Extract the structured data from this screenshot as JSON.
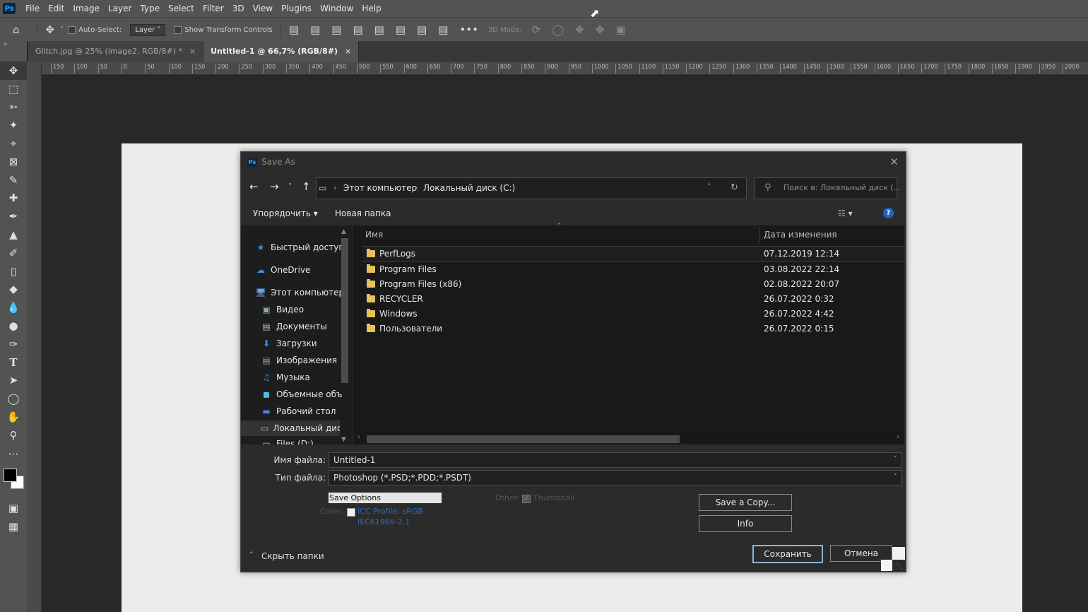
{
  "app": {
    "menu": [
      "File",
      "Edit",
      "Image",
      "Layer",
      "Type",
      "Select",
      "Filter",
      "3D",
      "View",
      "Plugins",
      "Window",
      "Help"
    ],
    "logo": "Ps"
  },
  "options_bar": {
    "auto_select_label": "Auto-Select:",
    "layer_select": "Layer",
    "show_transform_label": "Show Transform Controls",
    "more": "•••",
    "mode_3d_label": "3D Mode:"
  },
  "tabs": [
    {
      "label": "Glitch.jpg @ 25% (image2, RGB/8#) *",
      "close": "×"
    },
    {
      "label": "Untitled-1 @ 66,7% (RGB/8#)",
      "close": "×"
    }
  ],
  "ruler_ticks": [
    "150",
    "100",
    "50",
    "0",
    "50",
    "100",
    "150",
    "200",
    "250",
    "300",
    "350",
    "400",
    "450",
    "500",
    "550",
    "600",
    "650",
    "700",
    "750",
    "800",
    "850",
    "900",
    "950",
    "1000",
    "1050",
    "1100",
    "1150",
    "1200",
    "1250",
    "1300",
    "1350",
    "1400",
    "1450",
    "1500",
    "1550",
    "1600",
    "1650",
    "1700",
    "1750",
    "1800",
    "1850",
    "1900",
    "1950",
    "2000"
  ],
  "dialog": {
    "title": "Save As",
    "close": "✕",
    "address": {
      "crumbs": [
        "Этот компьютер",
        "Локальный диск (C:)"
      ]
    },
    "search_placeholder": "Поиск в: Локальный диск (...",
    "toolbar": {
      "organize": "Упорядочить ▾",
      "new_folder": "Новая папка",
      "help": "?"
    },
    "nav_items": [
      {
        "label": "Быстрый доступ",
        "icon": "star-icon"
      },
      {
        "label": "OneDrive",
        "icon": "cloud-icon"
      },
      {
        "label": "Этот компьютер",
        "icon": "computer-icon"
      },
      {
        "label": "Видео",
        "icon": "video-icon"
      },
      {
        "label": "Документы",
        "icon": "document-icon"
      },
      {
        "label": "Загрузки",
        "icon": "download-icon"
      },
      {
        "label": "Изображения",
        "icon": "image-icon"
      },
      {
        "label": "Музыка",
        "icon": "music-icon"
      },
      {
        "label": "Объемные объ",
        "icon": "cube-icon"
      },
      {
        "label": "Рабочий стол",
        "icon": "desktop-icon"
      },
      {
        "label": "Локальный дис",
        "icon": "disk-icon"
      },
      {
        "label": "Files (D:)",
        "icon": "disk-icon"
      }
    ],
    "columns": {
      "name": "Имя",
      "date": "Дата изменения"
    },
    "files": [
      {
        "name": "PerfLogs",
        "date": "07.12.2019 12:14"
      },
      {
        "name": "Program Files",
        "date": "03.08.2022 22:14"
      },
      {
        "name": "Program Files (x86)",
        "date": "02.08.2022 20:07"
      },
      {
        "name": "RECYCLER",
        "date": "26.07.2022 0:32"
      },
      {
        "name": "Windows",
        "date": "26.07.2022 4:42"
      },
      {
        "name": "Пользователи",
        "date": "26.07.2022 0:15"
      }
    ],
    "filename_label": "Имя файла:",
    "filename_value": "Untitled-1",
    "filetype_label": "Тип файла:",
    "filetype_value": "Photoshop (*.PSD;*.PDD;*.PSDT)",
    "save_options": "Save Options",
    "color_label": "Color:",
    "icc_profile": "ICC Profile:  sRGB",
    "icc_profile2": "IEC61966-2.1",
    "other_label": "Other:",
    "thumbnail": "Thumbnail",
    "save_copy": "Save a Copy...",
    "info": "Info",
    "hide_folders": "Скрыть папки",
    "save_button": "Сохранить",
    "cancel_button": "Отмена"
  }
}
